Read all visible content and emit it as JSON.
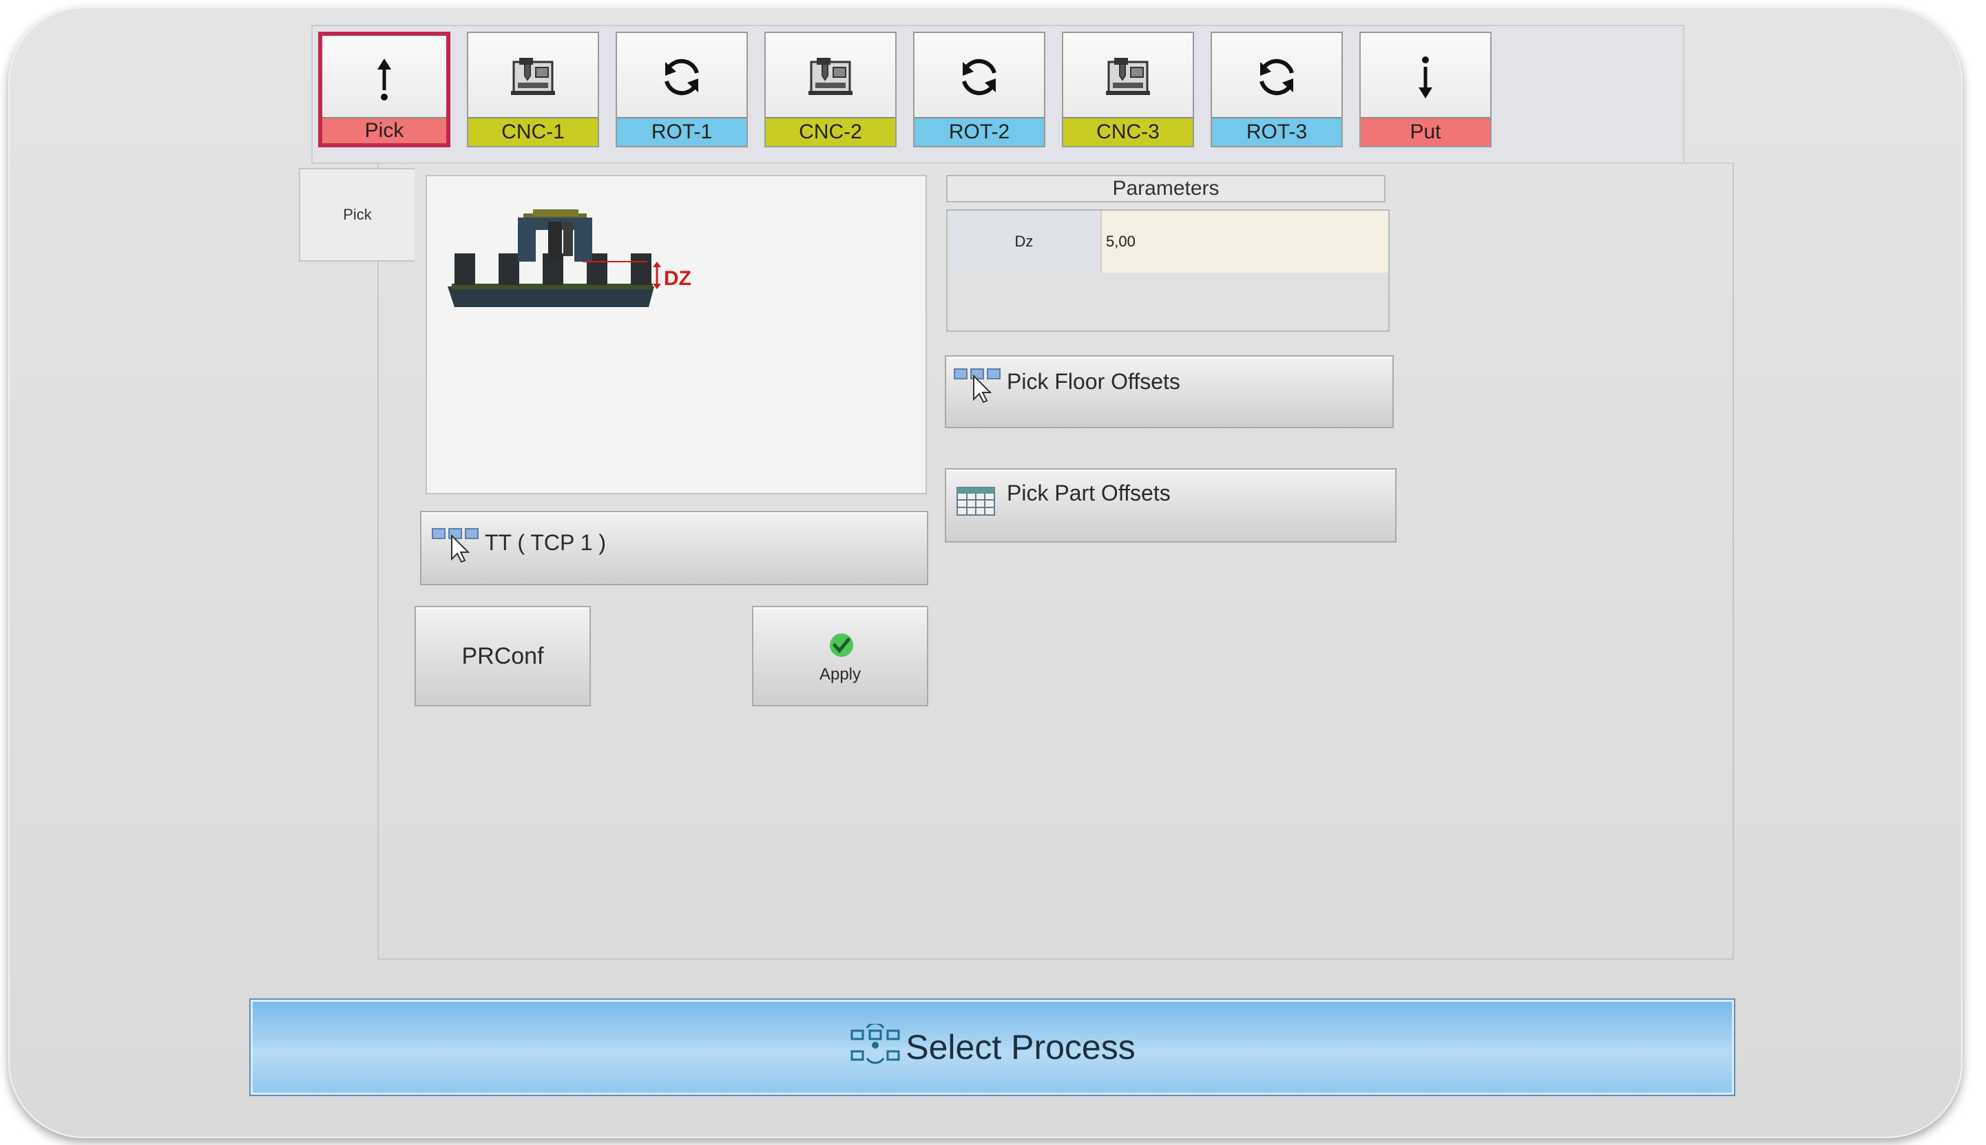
{
  "colors": {
    "pick": "#f27575",
    "put": "#f27575",
    "cnc": "#c9cc22",
    "rot": "#74c8ea",
    "active_border": "#c0284e",
    "select_bar": "#9fcef1"
  },
  "process_tabs": [
    {
      "label": "Pick",
      "icon": "arrow-up-icon",
      "kind": "pick",
      "active": true
    },
    {
      "label": "CNC-1",
      "icon": "cnc-machine-icon",
      "kind": "cnc",
      "active": false
    },
    {
      "label": "ROT-1",
      "icon": "rotate-icon",
      "kind": "rot",
      "active": false
    },
    {
      "label": "CNC-2",
      "icon": "cnc-machine-icon",
      "kind": "cnc",
      "active": false
    },
    {
      "label": "ROT-2",
      "icon": "rotate-icon",
      "kind": "rot",
      "active": false
    },
    {
      "label": "CNC-3",
      "icon": "cnc-machine-icon",
      "kind": "cnc",
      "active": false
    },
    {
      "label": "ROT-3",
      "icon": "rotate-icon",
      "kind": "rot",
      "active": false
    },
    {
      "label": "Put",
      "icon": "arrow-down-icon",
      "kind": "put",
      "active": false
    }
  ],
  "side_tab": {
    "label": "Pick"
  },
  "diagram": {
    "dim_label": "DZ"
  },
  "parameters": {
    "title": "Parameters",
    "rows": [
      {
        "key": "Dz",
        "value": "5,00"
      }
    ]
  },
  "buttons": {
    "pick_floor_offsets": "Pick Floor Offsets",
    "pick_part_offsets": "Pick Part Offsets",
    "tool": "TT ( TCP 1 )",
    "prconf": "PRConf",
    "apply": "Apply"
  },
  "select_process": {
    "label": "Select Process"
  }
}
